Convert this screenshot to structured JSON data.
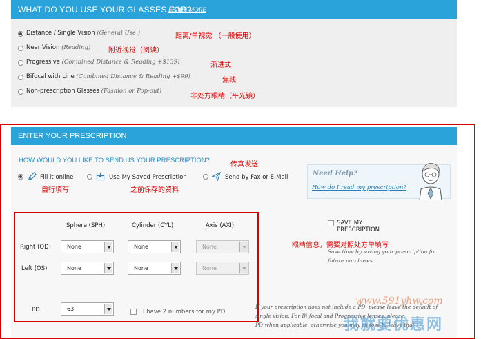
{
  "usage": {
    "title": "WHAT DO YOU USE YOUR GLASSES FOR?",
    "learn_more": "LEARN MORE",
    "options": [
      {
        "label": "Distance / Single Vision",
        "note": "(General Use )",
        "annotation": "距离/单视觉 （一般使用）",
        "selected": true
      },
      {
        "label": "Near Vision",
        "note": "(Reading)",
        "annotation": "附近视觉（阅读）",
        "selected": false
      },
      {
        "label": "Progressive",
        "note": "(Combined Distance & Reading +$139)",
        "annotation": "渐进式",
        "selected": false
      },
      {
        "label": "Bifocal with Line",
        "note": "(Combined Distance & Reading +$99)",
        "annotation": "焦线",
        "selected": false
      },
      {
        "label": "Non-prescription Glasses",
        "note": "(Fashion or Pop-out)",
        "annotation": "非处方眼睛（平光镜）",
        "selected": false
      }
    ]
  },
  "prescription": {
    "title": "ENTER YOUR PRESCRIPTION",
    "question": "HOW WOULD YOU LIKE TO SEND US YOUR PRESCRIPTION?",
    "fax_annotation": "传真发送",
    "methods": [
      {
        "label": "Fill it online",
        "icon": "pencil-icon",
        "annotation": "自行填写",
        "selected": true
      },
      {
        "label": "Use My Saved Prescription",
        "icon": "saved-box-icon",
        "annotation": "之前保存的资料",
        "selected": false
      },
      {
        "label": "Send by Fax or E-Mail",
        "icon": "paper-plane-icon",
        "selected": false
      }
    ],
    "help": {
      "title": "Need Help?",
      "link": "How do I read my prescription?",
      "avatar": "doctor-avatar-icon"
    },
    "columns": [
      "Sphere (SPH)",
      "Cylinder (CYL)",
      "Axis (AXI)"
    ],
    "rows": [
      {
        "label": "Right (OD)",
        "sph": "None",
        "cyl": "None",
        "axis": "None"
      },
      {
        "label": "Left (OS)",
        "sph": "None",
        "cyl": "None",
        "axis": "None"
      }
    ],
    "save": {
      "label_line1": "SAVE MY",
      "label_line2": "PRESCRIPTION",
      "annotation": "眼睛信息，需要对照处方单填写",
      "note_line1": "Save time by saving your prescription for",
      "note_line2": "future purchases."
    },
    "pd": {
      "label": "PD",
      "value": "63",
      "two_numbers_label": "I have 2 numbers for my PD",
      "note_line1": "If your prescription does not include a PD, please leave the default of",
      "note_line2": "single vision. For Bi-focal and Progressive lenses, please",
      "note_line3": "PD when applicable, otherwise you may choose to leave that"
    }
  },
  "watermark": {
    "url": "www.591yhw.com",
    "text": "我就要优惠网"
  },
  "colors": {
    "header_blue": "#29a3d9",
    "annotation_red": "#e30000",
    "link_blue": "#2a7fb8"
  }
}
